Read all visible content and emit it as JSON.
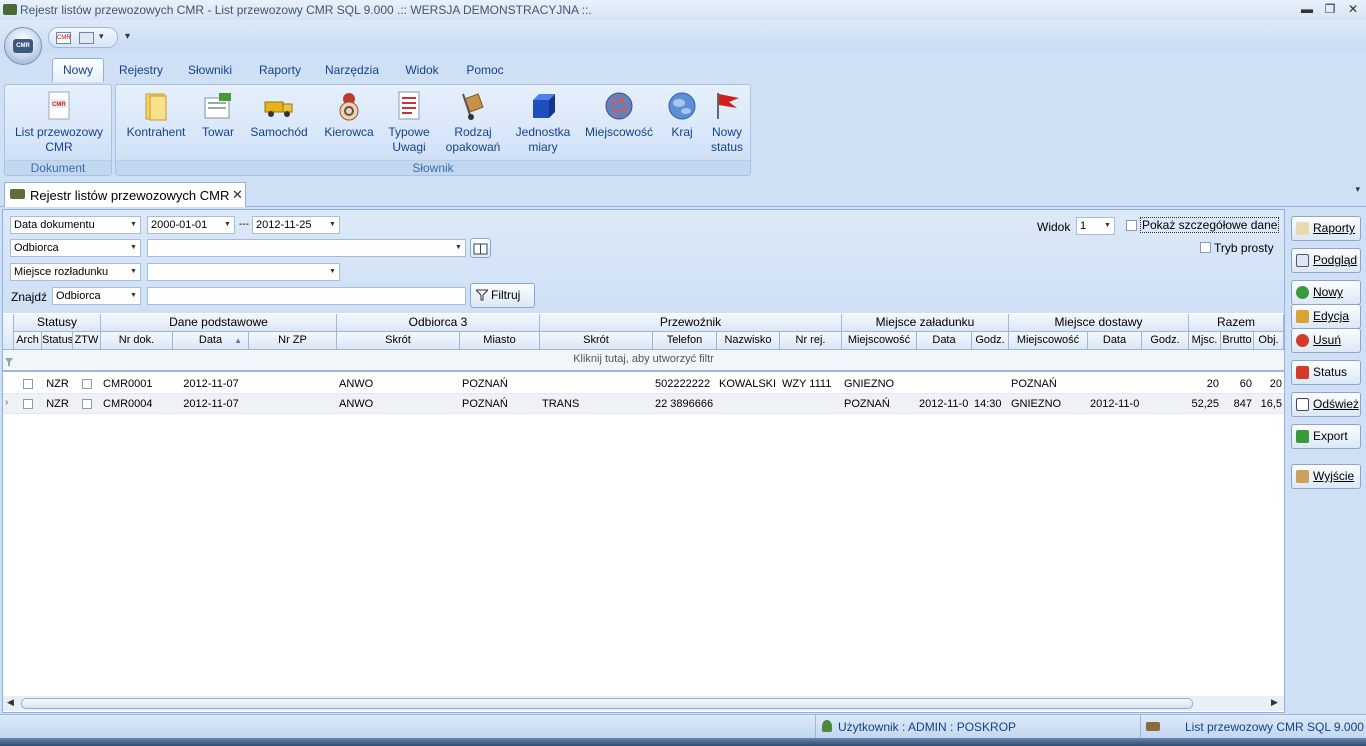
{
  "window": {
    "title": "Rejestr listów przewozowych CMR - List przewozowy CMR SQL 9.000 .:: WERSJA DEMONSTRACYJNA ::.",
    "min_glyph": "▬",
    "max_glyph": "❐",
    "close_glyph": "✕"
  },
  "qat": {
    "cmr_icon_text": "CMR",
    "overflow_glyph": "▾"
  },
  "ribbon": {
    "tabs": [
      "Nowy",
      "Rejestry",
      "Słowniki",
      "Raporty",
      "Narzędzia",
      "Widok",
      "Pomoc"
    ],
    "active_tab": "Nowy",
    "groups": {
      "dokument": {
        "label": "Dokument",
        "items": [
          {
            "label": "List przewozowy\nCMR",
            "icon": "cmr-document-icon"
          }
        ]
      },
      "slownik": {
        "label": "Słownik",
        "items": [
          {
            "label": "Kontrahent",
            "icon": "folder-icon"
          },
          {
            "label": "Towar",
            "icon": "goods-icon"
          },
          {
            "label": "Samochód",
            "icon": "truck-icon"
          },
          {
            "label": "Kierowca",
            "icon": "driver-icon"
          },
          {
            "label": "Typowe\nUwagi",
            "icon": "notes-icon"
          },
          {
            "label": "Rodzaj\nopakowań",
            "icon": "hand-truck-icon"
          },
          {
            "label": "Jednostka\nmiary",
            "icon": "cube-icon"
          },
          {
            "label": "Miejscowość",
            "icon": "city-icon"
          },
          {
            "label": "Kraj",
            "icon": "globe-icon"
          },
          {
            "label": "Nowy\nstatus",
            "icon": "flag-icon"
          }
        ]
      }
    }
  },
  "doc_tab": {
    "label": "Rejestr listów przewozowych CMR",
    "close": "✕"
  },
  "filters": {
    "date_field": "Data dokumentu",
    "date_from": "2000-01-01",
    "date_sep": "---",
    "date_to": "2012-11-25",
    "recipient_field": "Odbiorca",
    "recipient_value": "",
    "unload_field": "Miejsce rozładunku",
    "unload_value": "",
    "find_label": "Znajdź",
    "find_field": "Odbiorca",
    "find_value": "",
    "filter_button": "Filtruj",
    "view_label": "Widok",
    "view_value": "1",
    "show_details_label": "Pokaż szczegółowe dane",
    "simple_mode_label": "Tryb prosty"
  },
  "grid": {
    "bands": [
      "Statusy",
      "Dane podstawowe",
      "Odbiorca 3",
      "Przewoźnik",
      "Miejsce załadunku",
      "Miejsce dostawy",
      "Razem"
    ],
    "columns": [
      "Arch",
      "Status",
      "ZTW",
      "Nr dok.",
      "Data",
      "Nr ZP",
      "Skrót",
      "Miasto",
      "Skrót",
      "Telefon",
      "Nazwisko",
      "Nr rej.",
      "Miejscowość",
      "Data",
      "Godz.",
      "Miejscowość",
      "Data",
      "Godz.",
      "Mjsc.",
      "Brutto",
      "Obj."
    ],
    "filter_row_hint": "Kliknij tutaj, aby utworzyć filtr",
    "rows": [
      [
        "",
        "NZR",
        "",
        "CMR0001",
        "2012-11-07",
        "",
        "ANWO",
        "POZNAŃ",
        "",
        "502222222",
        "KOWALSKI",
        "WZY 1111",
        "GNIEZNO",
        "",
        "",
        "POZNAŃ",
        "",
        "",
        "20",
        "60",
        "20"
      ],
      [
        "",
        "NZR",
        "",
        "CMR0004",
        "2012-11-07",
        "",
        "ANWO",
        "POZNAŃ",
        "TRANS",
        "22 3896666",
        "",
        "",
        "POZNAŃ",
        "2012-11-0",
        "14:30",
        "GNIEZNO",
        "2012-11-0",
        "",
        "52,25",
        "847",
        "16,5"
      ]
    ]
  },
  "side_buttons": [
    "Raporty",
    "Podgląd",
    "Nowy",
    "Edycja",
    "Usuń",
    "Status",
    "Odśwież",
    "Export",
    "Wyjście"
  ],
  "status_bar": {
    "user": "Użytkownik : ADMIN : POSKROP",
    "product": "List przewozowy CMR SQL 9.000"
  },
  "colors": {
    "ribbon_bg": "#cfe0f5",
    "accent": "#15428b",
    "border": "#8db2e3"
  }
}
